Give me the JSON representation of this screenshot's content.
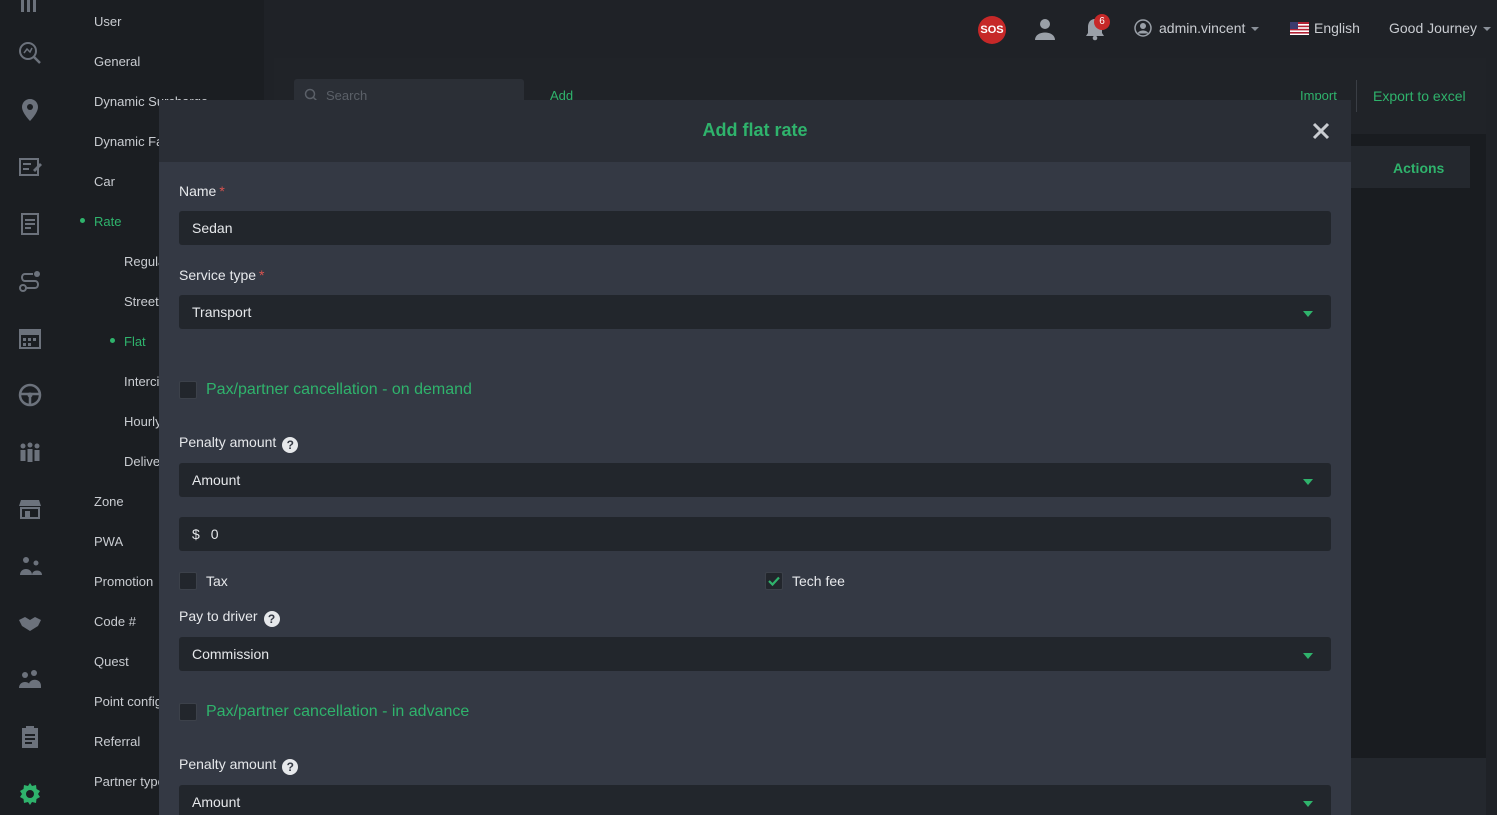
{
  "colors": {
    "accent": "#2fb36c",
    "required": "#d9534f",
    "badge": "#c62828"
  },
  "icon_rail": [
    "bars-chart-icon",
    "analytics-icon",
    "map-pin-icon",
    "booking-edit-icon",
    "report-list-icon",
    "route-icon",
    "calendar-icon",
    "steering-wheel-icon",
    "people-group-icon",
    "store-icon",
    "team-icon",
    "handshake-icon",
    "customer-group-icon",
    "clipboard-icon",
    "settings-gear-icon"
  ],
  "submenu": {
    "items": [
      {
        "label": "User"
      },
      {
        "label": "General"
      },
      {
        "label": "Dynamic Surcharge"
      },
      {
        "label": "Dynamic Fare"
      },
      {
        "label": "Car"
      },
      {
        "label": "Rate"
      },
      {
        "label": "Regular"
      },
      {
        "label": "Street"
      },
      {
        "label": "Flat"
      },
      {
        "label": "Intercity"
      },
      {
        "label": "Hourly"
      },
      {
        "label": "Delivery"
      },
      {
        "label": "Zone"
      },
      {
        "label": "PWA"
      },
      {
        "label": "Promotion"
      },
      {
        "label": "Code #"
      },
      {
        "label": "Quest"
      },
      {
        "label": "Point config"
      },
      {
        "label": "Referral"
      },
      {
        "label": "Partner type"
      }
    ]
  },
  "header": {
    "sos_label": "SOS",
    "notification_count": "6",
    "username": "admin.vincent",
    "language": "English",
    "company": "Good Journey"
  },
  "background": {
    "search_placeholder": "Search",
    "add_label": "Add",
    "import_label": "Import",
    "export_label": "Export to excel",
    "actions_header": "Actions"
  },
  "modal": {
    "title": "Add flat rate",
    "name_label": "Name",
    "name_required": "*",
    "name_value": "Sedan",
    "service_type_label": "Service type",
    "service_type_required": "*",
    "service_type_value": "Transport",
    "on_demand": {
      "label": "Pax/partner cancellation - on demand",
      "checked": false,
      "penalty_label": "Penalty amount",
      "penalty_type": "Amount",
      "currency": "$",
      "amount": "0",
      "tax_label": "Tax",
      "tax_checked": false,
      "tech_fee_label": "Tech fee",
      "tech_fee_checked": true,
      "pay_to_driver_label": "Pay to driver",
      "pay_to_driver_value": "Commission"
    },
    "in_advance": {
      "label": "Pax/partner cancellation - in advance",
      "checked": false,
      "penalty_label": "Penalty amount",
      "penalty_type": "Amount"
    }
  }
}
